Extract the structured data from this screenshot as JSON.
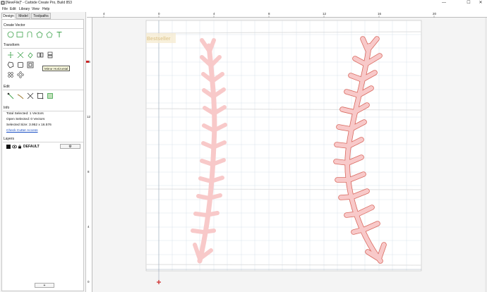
{
  "window": {
    "title": "[NewFile]* - Carbide Create Pro, Build 853",
    "controls": [
      "—",
      "☐",
      "✕"
    ]
  },
  "menu": [
    "File",
    "Edit",
    "Library",
    "View",
    "Help"
  ],
  "tabs": [
    "Design",
    "Model",
    "Toolpaths"
  ],
  "sections": {
    "create_vector": "Create Vector",
    "transform": "Transform",
    "edit": "Edit",
    "info": "Info",
    "layers": "Layers"
  },
  "tooltip": "Mirror Horizontal",
  "info": {
    "total_selected": "Total Selected:   1 Vectors",
    "open_selected": "Open Selected:   0 Vectors",
    "selected_size": "Selected Size:   3.952 x 16.576",
    "check_cutter": "Check Cutter Access"
  },
  "layer": {
    "name": "DEFAULT",
    "gear": "⚙",
    "add": "+"
  },
  "ruler_top": [
    "4",
    "0",
    "4",
    "8",
    "12",
    "16",
    "20"
  ],
  "ruler_left": [
    "16",
    "12",
    "8",
    "4",
    "0"
  ],
  "watermark": "Bestseller",
  "colors": {
    "stitch_fill": "#f8c9c9",
    "stitch_stroke": "#d9695f",
    "grid": "#c9d6e6",
    "accent": "#cc2222"
  },
  "icons": {
    "create": [
      "circle-icon",
      "rectangle-icon",
      "rounded-rect-icon",
      "polygon-icon",
      "pentagon-icon",
      "text-icon"
    ],
    "transform": [
      "move-icon",
      "scale-icon",
      "rotate-icon",
      "mirror-horizontal-icon",
      "mirror-vertical-icon",
      "offset-icon",
      "align-icon",
      "group-icon",
      "array-icon",
      "circular-array-icon"
    ],
    "edit": [
      "node-edit-icon",
      "trim-icon",
      "join-icon",
      "boolean-icon",
      "weld-icon"
    ]
  }
}
